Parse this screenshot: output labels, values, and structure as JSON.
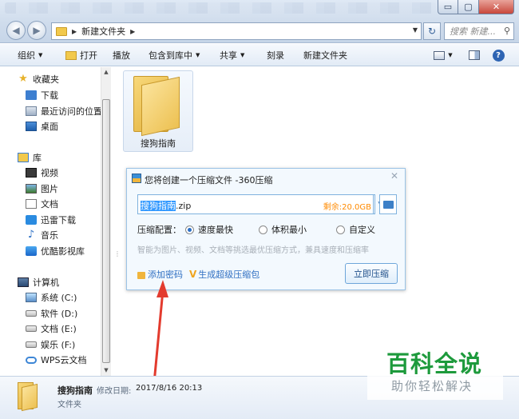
{
  "window": {
    "address": {
      "crumb": "新建文件夹"
    },
    "search_placeholder": "搜索 新建...",
    "controls": {
      "min": "▭",
      "max": "▢",
      "close": "✕"
    }
  },
  "toolbar": {
    "organize": "组织",
    "open": "打开",
    "play": "播放",
    "include": "包含到库中",
    "share": "共享",
    "burn": "刻录",
    "new_folder": "新建文件夹"
  },
  "sidebar": {
    "favorites": {
      "label": "收藏夹",
      "items": [
        {
          "label": "下载",
          "icon": "download-folder-icon"
        },
        {
          "label": "最近访问的位置",
          "icon": "recent-places-icon"
        },
        {
          "label": "桌面",
          "icon": "desktop-icon"
        }
      ]
    },
    "libraries": {
      "label": "库",
      "items": [
        {
          "label": "视频",
          "icon": "video-library-icon"
        },
        {
          "label": "图片",
          "icon": "picture-library-icon"
        },
        {
          "label": "文档",
          "icon": "document-library-icon"
        },
        {
          "label": "迅雷下载",
          "icon": "xunlei-icon"
        },
        {
          "label": "音乐",
          "icon": "music-library-icon"
        },
        {
          "label": "优酷影视库",
          "icon": "youku-icon"
        }
      ]
    },
    "computer": {
      "label": "计算机",
      "items": [
        {
          "label": "系统 (C:)",
          "icon": "system-drive-icon"
        },
        {
          "label": "软件 (D:)",
          "icon": "drive-icon"
        },
        {
          "label": "文档 (E:)",
          "icon": "drive-icon"
        },
        {
          "label": "娱乐 (F:)",
          "icon": "drive-icon"
        },
        {
          "label": "WPS云文档",
          "icon": "cloud-icon"
        }
      ]
    }
  },
  "content": {
    "folder_name": "搜狗指南"
  },
  "dialog": {
    "title": "您将创建一个压缩文件 -360压缩",
    "file_name_selected": "搜狗指南",
    "file_ext": ".zip",
    "free_space": "剩余:20.0GB",
    "config_label": "压缩配置：",
    "options": [
      {
        "label": "速度最快",
        "selected": true
      },
      {
        "label": "体积最小",
        "selected": false
      },
      {
        "label": "自定义",
        "selected": false
      }
    ],
    "hint": "智能为图片、视频、文档等挑选最优压缩方式，兼具速度和压缩率",
    "add_password": "添加密码",
    "super_compress": "生成超级压缩包",
    "compress_now": "立即压缩",
    "close": "✕"
  },
  "details": {
    "name": "搜狗指南",
    "modified_label": "修改日期:",
    "modified_date": "2017/8/16 20:13",
    "type": "文件夹"
  },
  "watermark": {
    "title": "百科全说",
    "subtitle": "助你轻松解决"
  },
  "colors": {
    "accent_blue": "#2f6fc2",
    "free_space_orange": "#ff8a00",
    "arrow_red": "#e33b2e",
    "watermark_green": "#1d9a3c"
  }
}
